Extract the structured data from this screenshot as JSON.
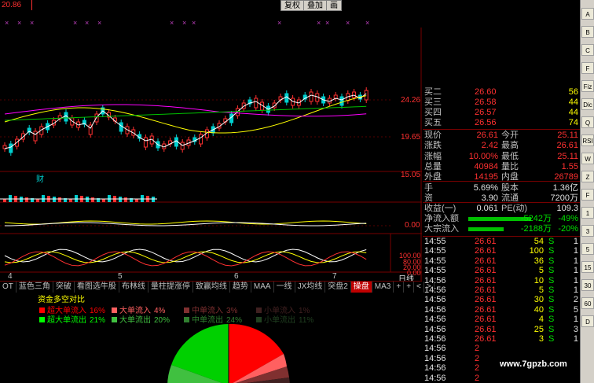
{
  "toolbar": {
    "top_left_value": "20.86",
    "buttons": [
      "复权",
      "叠加",
      "画"
    ]
  },
  "price_axis": [
    "24.26",
    "19.65",
    "15.05"
  ],
  "indicator_axis": [
    "0.00"
  ],
  "macd_axis": [
    "100.00",
    "80.00",
    "20.00",
    "0.00"
  ],
  "date_labels": [
    "4",
    "5",
    "6",
    "7"
  ],
  "date_right_label": "日线",
  "indicator_tabs": [
    "OT",
    "蓝色三角",
    "突破",
    "看图选牛股",
    "布林线",
    "量柱提涨停",
    "致赢均线",
    "趋势",
    "MAA",
    "一线",
    "JX均线",
    "突盘2",
    "操盘",
    "MA3"
  ],
  "tab_active": "操盘",
  "tab_arrows": [
    "+",
    "+",
    "<",
    ">"
  ],
  "fund_panel": {
    "title": "资金多空对比",
    "legend_row1": [
      {
        "label": "超大单流入",
        "value": "16%",
        "color": "#ff0000"
      },
      {
        "label": "大单流入",
        "value": "4%",
        "color": "#ff6060"
      },
      {
        "label": "中单流入",
        "value": "3%",
        "color": "#803030"
      },
      {
        "label": "小单流入",
        "value": "1%",
        "color": "#402020"
      }
    ],
    "legend_row2": [
      {
        "label": "超大单流出",
        "value": "21%",
        "color": "#00ff00"
      },
      {
        "label": "大单流出",
        "value": "20%",
        "color": "#40c040"
      },
      {
        "label": "中单流出",
        "value": "24%",
        "color": "#308030"
      },
      {
        "label": "小单流出",
        "value": "11%",
        "color": "#204020"
      }
    ]
  },
  "order_book": [
    {
      "label": "买二",
      "price": "26.60",
      "vol": "56"
    },
    {
      "label": "买三",
      "price": "26.58",
      "vol": "44"
    },
    {
      "label": "买四",
      "price": "26.57",
      "vol": "44"
    },
    {
      "label": "买五",
      "price": "26.56",
      "vol": "74"
    }
  ],
  "quote": [
    {
      "l1": "现价",
      "v1": "26.61",
      "l2": "今开",
      "v2": "25.11"
    },
    {
      "l1": "涨跌",
      "v1": "2.42",
      "l2": "最高",
      "v2": "26.61"
    },
    {
      "l1": "涨幅",
      "v1": "10.00%",
      "l2": "最低",
      "v2": "25.11"
    },
    {
      "l1": "总量",
      "v1": "40984",
      "l2": "量比",
      "v2": "1.55"
    },
    {
      "l1": "外盘",
      "v1": "14195",
      "l2": "内盘",
      "v2": "26789"
    },
    {
      "l1": "手",
      "v1": "5.69%",
      "l2": "股本",
      "v2": "1.36亿"
    },
    {
      "l1": "资",
      "v1": "3.90",
      "l2": "流通",
      "v2": "7200万"
    },
    {
      "l1": "收益(一)",
      "v1": "0.061",
      "l2": "PE(动)",
      "v2": "109.3"
    }
  ],
  "flows": [
    {
      "label": "净流入额",
      "value": "-5242万",
      "pct": "-49%"
    },
    {
      "label": "大宗流入",
      "value": "-2188万",
      "pct": "-20%"
    }
  ],
  "ticks": [
    {
      "time": "14:55",
      "price": "26.61",
      "vol": "54",
      "bs": "S",
      "n": "1"
    },
    {
      "time": "14:55",
      "price": "26.61",
      "vol": "100",
      "bs": "S",
      "n": "1"
    },
    {
      "time": "14:55",
      "price": "26.61",
      "vol": "36",
      "bs": "S",
      "n": "1"
    },
    {
      "time": "14:55",
      "price": "26.61",
      "vol": "5",
      "bs": "S",
      "n": "1"
    },
    {
      "time": "14:56",
      "price": "26.61",
      "vol": "10",
      "bs": "S",
      "n": "1"
    },
    {
      "time": "14:56",
      "price": "26.61",
      "vol": "5",
      "bs": "S",
      "n": "1"
    },
    {
      "time": "14:56",
      "price": "26.61",
      "vol": "30",
      "bs": "S",
      "n": "2"
    },
    {
      "time": "14:56",
      "price": "26.61",
      "vol": "40",
      "bs": "S",
      "n": "5"
    },
    {
      "time": "14:56",
      "price": "26.61",
      "vol": "4",
      "bs": "S",
      "n": "1"
    },
    {
      "time": "14:56",
      "price": "26.61",
      "vol": "25",
      "bs": "S",
      "n": "3"
    },
    {
      "time": "14:56",
      "price": "26.61",
      "vol": "3",
      "bs": "S",
      "n": "1"
    },
    {
      "time": "14:56",
      "price": "2",
      "vol": "",
      "bs": "",
      "n": ""
    },
    {
      "time": "14:56",
      "price": "2",
      "vol": "",
      "bs": "",
      "n": ""
    },
    {
      "time": "14:56",
      "price": "2",
      "vol": "",
      "bs": "",
      "n": ""
    },
    {
      "time": "14:56",
      "price": "2",
      "vol": "",
      "bs": "",
      "n": ""
    }
  ],
  "side_buttons": [
    "A",
    "B",
    "C",
    "F",
    "Fiz",
    "Dic",
    "Q",
    "RSI",
    "W",
    "Z",
    "F",
    "1",
    "3",
    "5",
    "15",
    "30",
    "60",
    "D"
  ],
  "watermark": "www.7gpzb.com",
  "vol_marker": "财"
}
